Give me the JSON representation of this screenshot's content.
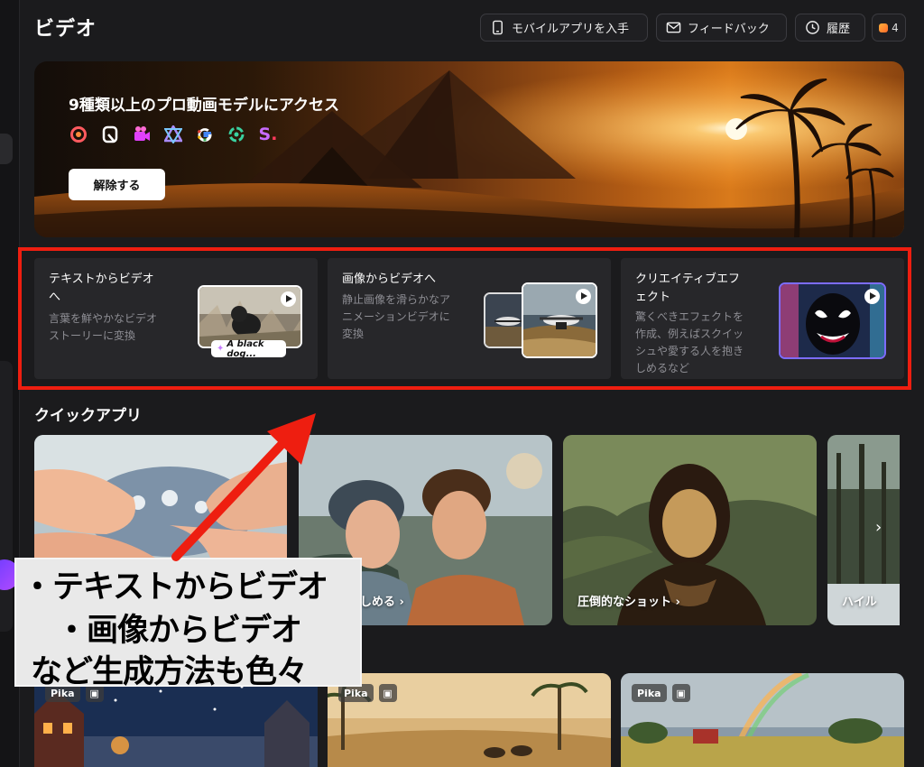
{
  "header": {
    "title": "ビデオ",
    "mobile_app_label": "モバイルアプリを入手",
    "feedback_label": "フィードバック",
    "history_label": "履歴",
    "credits": "4"
  },
  "banner": {
    "title": "9種類以上のプロ動画モデルにアクセス",
    "unlock_label": "解除する",
    "logos": [
      "hailuo-logo",
      "runway-logo",
      "luma-logo",
      "kling-logo",
      "google-logo",
      "openai-logo",
      "s-logo"
    ]
  },
  "features": [
    {
      "title": "テキストからビデオへ",
      "description": "言葉を鮮やかなビデオストーリーに変換",
      "prompt": "A black dog..."
    },
    {
      "title": "画像からビデオへ",
      "description": "静止画像を滑らかなアニメーションビデオに変換"
    },
    {
      "title": "クリエイティブエフェクト",
      "description": "驚くべきエフェクトを作成、例えばスクイッシュや愛する人を抱きしめるなど"
    }
  ],
  "quick_apps": {
    "title": "クイックアプリ",
    "items": [
      {
        "label": ""
      },
      {
        "label": "人を抱きしめる ›"
      },
      {
        "label": "圧倒的なショット ›"
      },
      {
        "label": "ハイル"
      }
    ]
  },
  "video_cards": [
    {
      "model": "Pika"
    },
    {
      "model": "Pika"
    },
    {
      "model": "Pika"
    }
  ],
  "annotation": {
    "lines": [
      "・テキストからビデオ",
      "・画像からビデオ",
      "など生成方法も色々"
    ]
  },
  "colors": {
    "highlight": "#ee1e10",
    "background": "#1b1b1d",
    "card": "#27272a"
  }
}
